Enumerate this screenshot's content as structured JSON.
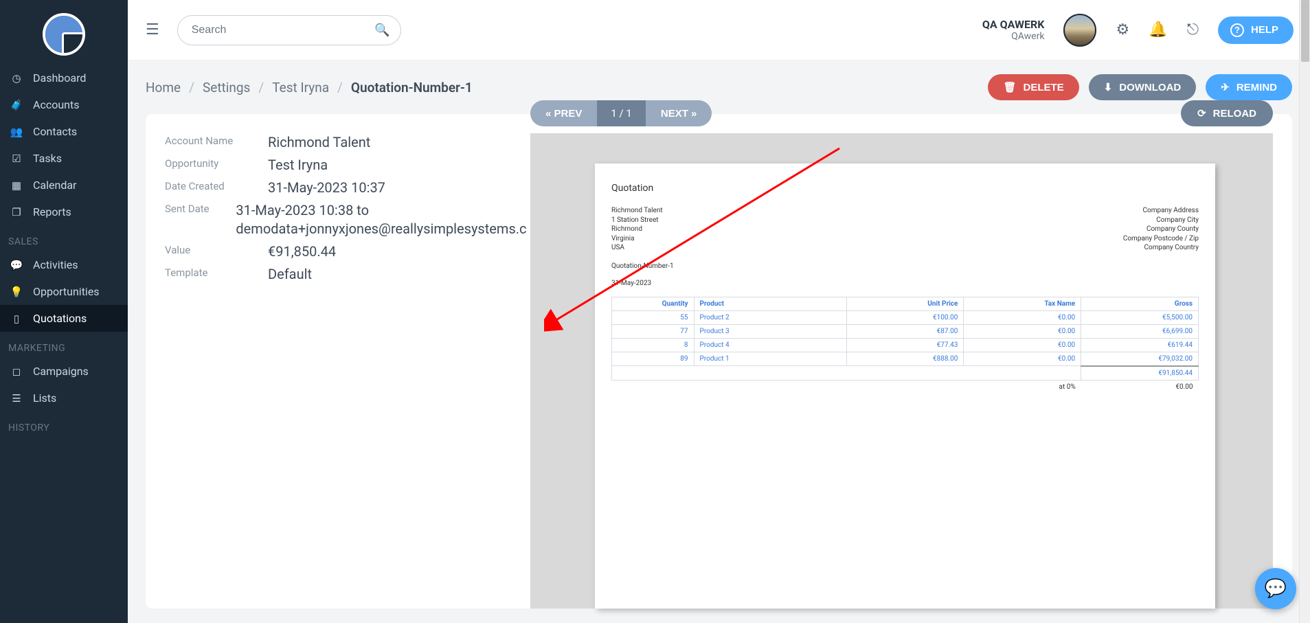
{
  "sidebar": {
    "items": [
      {
        "label": "Dashboard",
        "icon": "gauge"
      },
      {
        "label": "Accounts",
        "icon": "briefcase"
      },
      {
        "label": "Contacts",
        "icon": "users"
      },
      {
        "label": "Tasks",
        "icon": "check-square"
      },
      {
        "label": "Calendar",
        "icon": "calendar"
      },
      {
        "label": "Reports",
        "icon": "file"
      }
    ],
    "sections": {
      "sales": "SALES",
      "marketing": "MARKETING",
      "history": "HISTORY"
    },
    "sales_items": [
      {
        "label": "Activities",
        "icon": "comment"
      },
      {
        "label": "Opportunities",
        "icon": "bulb"
      },
      {
        "label": "Quotations",
        "icon": "doc",
        "active": true
      }
    ],
    "marketing_items": [
      {
        "label": "Campaigns",
        "icon": "inbox"
      },
      {
        "label": "Lists",
        "icon": "list"
      }
    ]
  },
  "topbar": {
    "search_placeholder": "Search",
    "user_name": "QA QAWERK",
    "user_org": "QAwerk",
    "help_label": "HELP"
  },
  "breadcrumb": {
    "home": "Home",
    "settings": "Settings",
    "opp": "Test Iryna",
    "current": "Quotation-Number-1"
  },
  "actions": {
    "delete": "DELETE",
    "download": "DOWNLOAD",
    "remind": "REMIND"
  },
  "pager": {
    "prev": "« PREV",
    "mid": "1 / 1",
    "next": "NEXT »",
    "reload": "RELOAD"
  },
  "details": {
    "labels": {
      "account": "Account Name",
      "opportunity": "Opportunity",
      "created": "Date Created",
      "sent": "Sent Date",
      "value": "Value",
      "template": "Template"
    },
    "values": {
      "account": "Richmond Talent",
      "opportunity": "Test Iryna",
      "created": "31-May-2023 10:37",
      "sent": "31-May-2023 10:38 to demodata+jonnyxjones@reallysimplesystems.c",
      "value": "€91,850.44",
      "template": "Default"
    }
  },
  "document": {
    "title": "Quotation",
    "customer": [
      "Richmond Talent",
      "1 Station Street",
      "Richmond",
      "Virginia",
      "USA"
    ],
    "company": [
      "Company Address",
      "Company City",
      "Company County",
      "Company Postcode / Zip",
      "Company Country"
    ],
    "number": "Quotation-Number-1",
    "date": "31-May-2023",
    "columns": {
      "qty": "Quantity",
      "product": "Product",
      "unit": "Unit Price",
      "tax": "Tax Name",
      "gross": "Gross"
    },
    "lines": [
      {
        "qty": "55",
        "product": "Product 2",
        "unit": "€100.00",
        "tax": "€0.00",
        "gross": "€5,500.00"
      },
      {
        "qty": "77",
        "product": "Product 3",
        "unit": "€87.00",
        "tax": "€0.00",
        "gross": "€6,699.00"
      },
      {
        "qty": "8",
        "product": "Product 4",
        "unit": "€77.43",
        "tax": "€0.00",
        "gross": "€619.44"
      },
      {
        "qty": "89",
        "product": "Product 1",
        "unit": "€888.00",
        "tax": "€0.00",
        "gross": "€79,032.00"
      }
    ],
    "subtotal_gross": "€91,850.44",
    "tax_label": "at 0%",
    "tax_amount": "€0.00"
  }
}
